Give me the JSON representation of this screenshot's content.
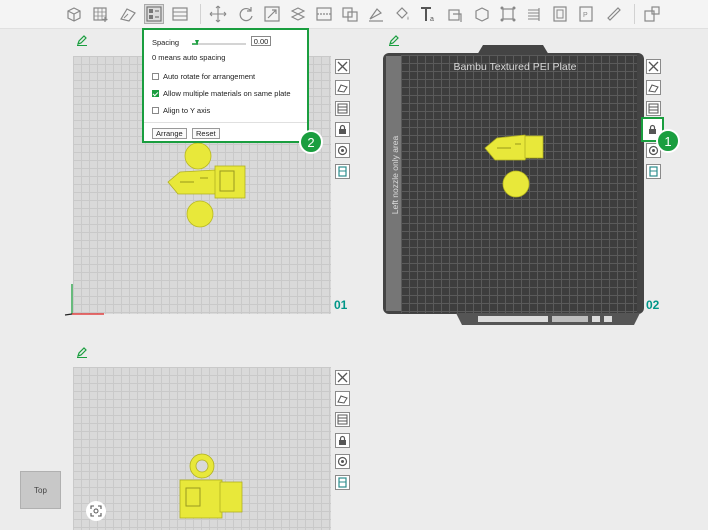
{
  "window": {
    "corner_mark": "sb"
  },
  "toolbar": {
    "icons": [
      "add-object-icon",
      "add-plate-icon",
      "auto-orient-icon",
      "arrange-icon",
      "split-plates-icon",
      "move-icon",
      "rotate-icon",
      "scale-icon",
      "lay-on-face-icon",
      "cut-icon",
      "paint-support-icon",
      "color-paint-icon",
      "text-icon",
      "emboss-icon",
      "measure-icon",
      "assembly-icon",
      "boolean-icon",
      "variable-layer-icon",
      "seam-icon",
      "brim-ear-icon",
      "more-icon"
    ]
  },
  "plates": [
    {
      "number": "01"
    },
    {
      "number": "02",
      "bed_title": "Bambu Textured PEI Plate",
      "side_label": "Left nozzle only area"
    },
    {
      "number": ""
    }
  ],
  "arrange_popup": {
    "spacing_label": "Spacing",
    "spacing_value": "0.00",
    "hint": "0 means auto spacing",
    "auto_rotate_label": "Auto rotate for arrangement",
    "auto_rotate_checked": false,
    "multi_material_label": "Allow multiple materials on same plate",
    "multi_material_checked": true,
    "align_y_label": "Align to Y axis",
    "align_y_checked": false,
    "arrange_button": "Arrange",
    "reset_button": "Reset"
  },
  "badges": {
    "one": "1",
    "two": "2"
  },
  "view_cube": {
    "label": "Top"
  },
  "colors": {
    "accent": "#1a9e3f",
    "model": "#e8e83a",
    "plate_number": "#009688"
  }
}
